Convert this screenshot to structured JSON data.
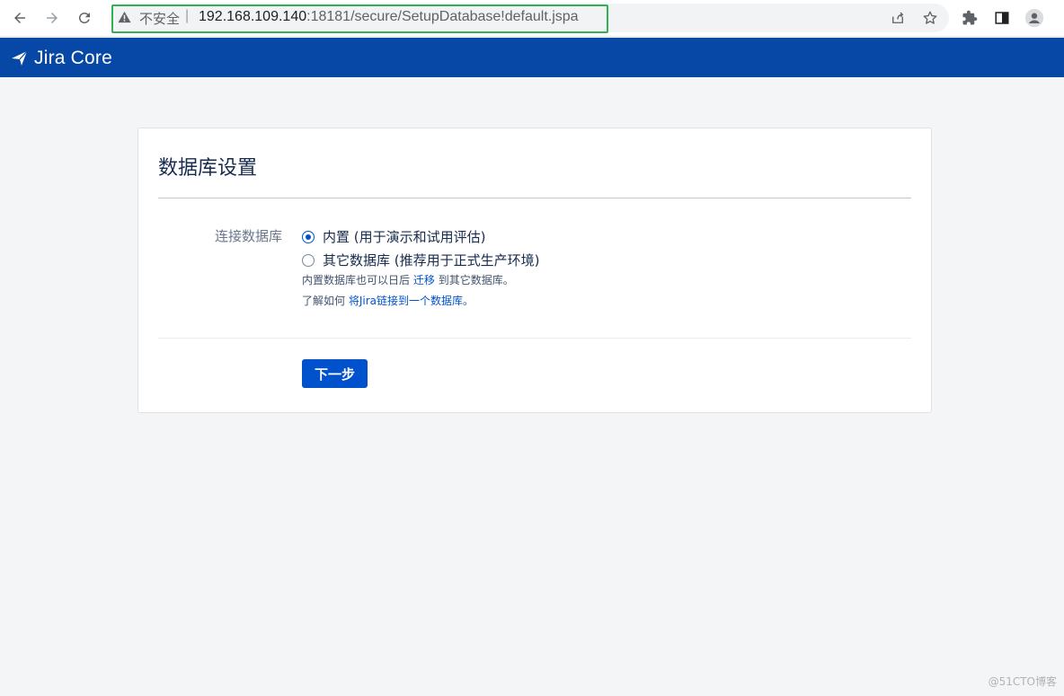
{
  "browser": {
    "insecure_label": "不安全",
    "separator": "|",
    "url_host": "192.168.109.140",
    "url_path": ":18181/secure/SetupDatabase!default.jspa"
  },
  "header": {
    "product_name": "Jira Core",
    "brand_color": "#0747a6"
  },
  "form": {
    "title": "数据库设置",
    "field_label": "连接数据库",
    "options": [
      {
        "label": "内置 (用于演示和试用评估)",
        "selected": true
      },
      {
        "label": "其它数据库 (推荐用于正式生产环境)",
        "selected": false
      }
    ],
    "help1_pre": "内置数据库也可以日后",
    "help1_link": "迁移",
    "help1_post": "到其它数据库。",
    "help2_pre": "了解如何",
    "help2_link": "将Jira链接到一个数据库",
    "help2_post": "。",
    "next_button": "下一步"
  },
  "watermark": "@51CTO博客",
  "icons": [
    "back-icon",
    "forward-icon",
    "reload-icon",
    "warning-icon",
    "share-icon",
    "star-icon",
    "extensions-icon",
    "side-panel-icon",
    "profile-icon",
    "jira-logo-icon"
  ]
}
